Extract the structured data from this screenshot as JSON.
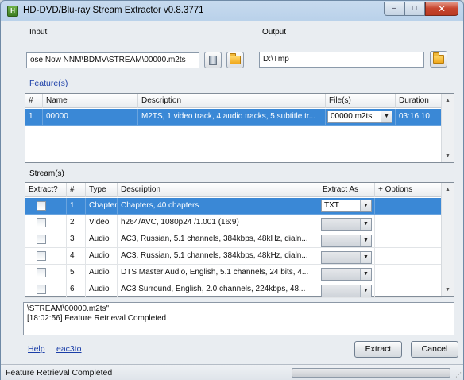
{
  "window": {
    "icon_label": "H",
    "title": "HD-DVD/Blu-ray Stream Extractor v0.8.3771",
    "controls": {
      "minimize": "–",
      "maximize": "□",
      "close": "✕"
    }
  },
  "input": {
    "label": "Input",
    "value": "ose Now NNM\\BDMV\\STREAM\\00000.m2ts"
  },
  "output": {
    "label": "Output",
    "value": "D:\\Tmp"
  },
  "features": {
    "link_label": "Feature(s)",
    "columns": [
      "#",
      "Name",
      "Description",
      "File(s)",
      "Duration"
    ],
    "rows": [
      {
        "num": "1",
        "name": "00000",
        "description": "M2TS, 1 video track, 4 audio tracks, 5 subtitle tr...",
        "file": "00000.m2ts",
        "duration": "03:16:10"
      }
    ]
  },
  "streams": {
    "label": "Stream(s)",
    "columns": [
      "Extract?",
      "#",
      "Type",
      "Description",
      "Extract As",
      "+ Options"
    ],
    "rows": [
      {
        "num": "1",
        "type": "Chapter",
        "description": "Chapters, 40 chapters",
        "extract_as": "TXT",
        "selected": true
      },
      {
        "num": "2",
        "type": "Video",
        "description": "h264/AVC, 1080p24 /1.001 (16:9)",
        "extract_as": "",
        "selected": false
      },
      {
        "num": "3",
        "type": "Audio",
        "description": "AC3, Russian, 5.1 channels, 384kbps, 48kHz, dialn...",
        "extract_as": "",
        "selected": false
      },
      {
        "num": "4",
        "type": "Audio",
        "description": "AC3, Russian, 5.1 channels, 384kbps, 48kHz, dialn...",
        "extract_as": "",
        "selected": false
      },
      {
        "num": "5",
        "type": "Audio",
        "description": "DTS Master Audio, English, 5.1 channels, 24 bits, 4...",
        "extract_as": "",
        "selected": false
      },
      {
        "num": "6",
        "type": "Audio",
        "description": "AC3 Surround, English, 2.0 channels, 224kbps, 48...",
        "extract_as": "",
        "selected": false
      }
    ]
  },
  "log": {
    "lines": [
      "\\STREAM\\00000.m2ts\"",
      "[18:02:56] Feature Retrieval Completed"
    ]
  },
  "links": {
    "help": "Help",
    "eac3to": "eac3to"
  },
  "buttons": {
    "extract": "Extract",
    "cancel": "Cancel"
  },
  "status": {
    "text": "Feature Retrieval Completed"
  },
  "colors": {
    "selection": "#3a88d6",
    "link": "#1a3ea8",
    "close_button": "#c7452e"
  },
  "icons": [
    "app-icon",
    "drive-icon",
    "folder-icon",
    "dropdown-arrow-icon",
    "scroll-up-icon",
    "scroll-down-icon",
    "size-grip-icon"
  ]
}
